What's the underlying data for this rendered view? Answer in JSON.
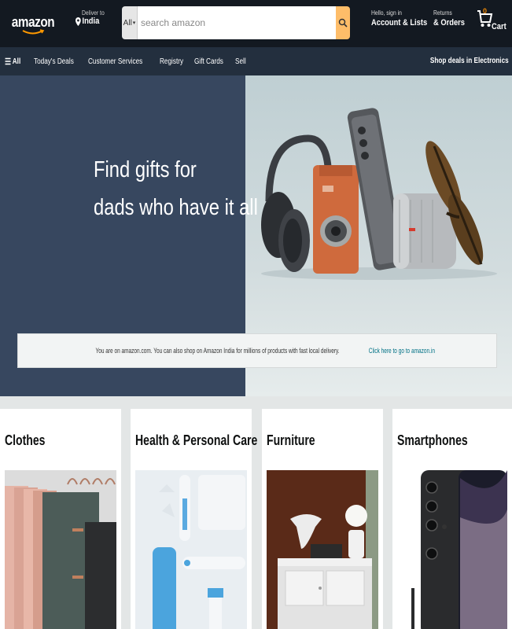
{
  "header": {
    "logo_text": "amazon",
    "deliver_small": "Deliver to",
    "deliver_location": "India",
    "search_category": "All",
    "search_placeholder": "search amazon",
    "account_small": "Hello, sign in",
    "account_big": "Account & Lists",
    "returns_small": "Returns",
    "returns_big": "& Orders",
    "cart_label": "Cart",
    "cart_count": "0"
  },
  "subnav": {
    "all_label": "All",
    "items": [
      "Today's Deals",
      "Customer Services",
      "Registry",
      "Gift Cards",
      "Sell"
    ],
    "right_label": "Shop deals in Electronics"
  },
  "hero": {
    "title_line1": "Find gifts for",
    "title_line2": "dads who have it all"
  },
  "notice": {
    "text": "You are on amazon.com. You can also shop on Amazon India for millions of products with fast local delivery.",
    "link": "Click here to go to amazon.in"
  },
  "cards": [
    {
      "title": "Clothes"
    },
    {
      "title": "Health & Personal Care"
    },
    {
      "title": "Furniture"
    },
    {
      "title": "Smartphones"
    }
  ],
  "colors": {
    "nav_bg": "#131921",
    "subnav_bg": "#232f3e",
    "search_button": "#febd69",
    "hero_left": "#37475f",
    "link": "#007185"
  }
}
